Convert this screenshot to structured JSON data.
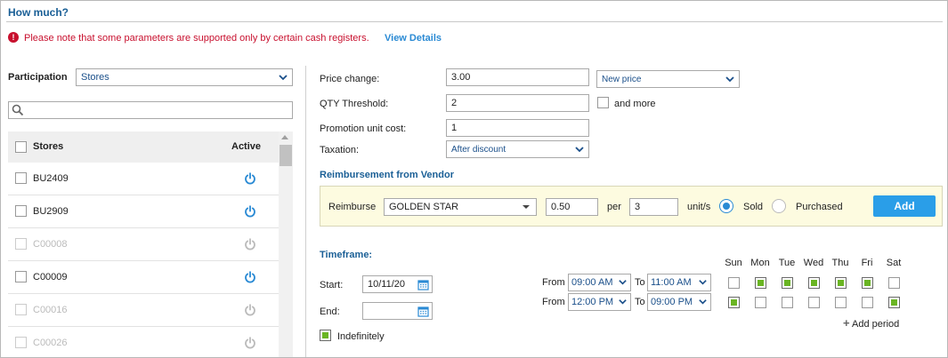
{
  "header": {
    "title": "How much?"
  },
  "notice": {
    "icon": "!",
    "text": "Please note that some parameters are supported only by certain cash registers.",
    "link": "View Details"
  },
  "participation": {
    "label": "Participation",
    "value": "Stores"
  },
  "store_list": {
    "col_stores": "Stores",
    "col_active": "Active",
    "rows": [
      {
        "label": "BU2409",
        "enabled": true
      },
      {
        "label": "BU2909",
        "enabled": true
      },
      {
        "label": "C00008",
        "enabled": false
      },
      {
        "label": "C00009",
        "enabled": true
      },
      {
        "label": "C00016",
        "enabled": false
      },
      {
        "label": "C00026",
        "enabled": false
      }
    ]
  },
  "pricing": {
    "price_change_label": "Price change:",
    "price_change_value": "3.00",
    "price_type": "New price",
    "qty_label": "QTY Threshold:",
    "qty_value": "2",
    "and_more_label": "and more",
    "unit_cost_label": "Promotion unit cost:",
    "unit_cost_value": "1",
    "taxation_label": "Taxation:",
    "taxation_value": "After discount"
  },
  "reimbursement": {
    "title": "Reimbursement from Vendor",
    "reimburse_label": "Reimburse",
    "vendor": "GOLDEN STAR",
    "amount": "0.50",
    "per_label": "per",
    "units": "3",
    "units_label": "unit/s",
    "sold_label": "Sold",
    "purchased_label": "Purchased",
    "selected": "Sold",
    "add_label": "Add"
  },
  "timeframe": {
    "title": "Timeframe:",
    "start_label": "Start:",
    "start_value": "10/11/20",
    "end_label": "End:",
    "end_value": "",
    "indefinitely_label": "Indefinitely",
    "indefinitely": true,
    "days": [
      "Sun",
      "Mon",
      "Tue",
      "Wed",
      "Thu",
      "Fri",
      "Sat"
    ],
    "from_label": "From",
    "to_label": "To",
    "periods": [
      {
        "from": "09:00 AM",
        "to": "11:00 AM",
        "days": [
          false,
          true,
          true,
          true,
          true,
          true,
          false
        ]
      },
      {
        "from": "12:00 PM",
        "to": "09:00 PM",
        "days": [
          true,
          false,
          false,
          false,
          false,
          false,
          true
        ]
      }
    ],
    "add_period_label": "Add period"
  },
  "colors": {
    "accent": "#2a9ee8",
    "title": "#1a5f96",
    "warning": "#c8102e",
    "check": "#6ab523"
  }
}
